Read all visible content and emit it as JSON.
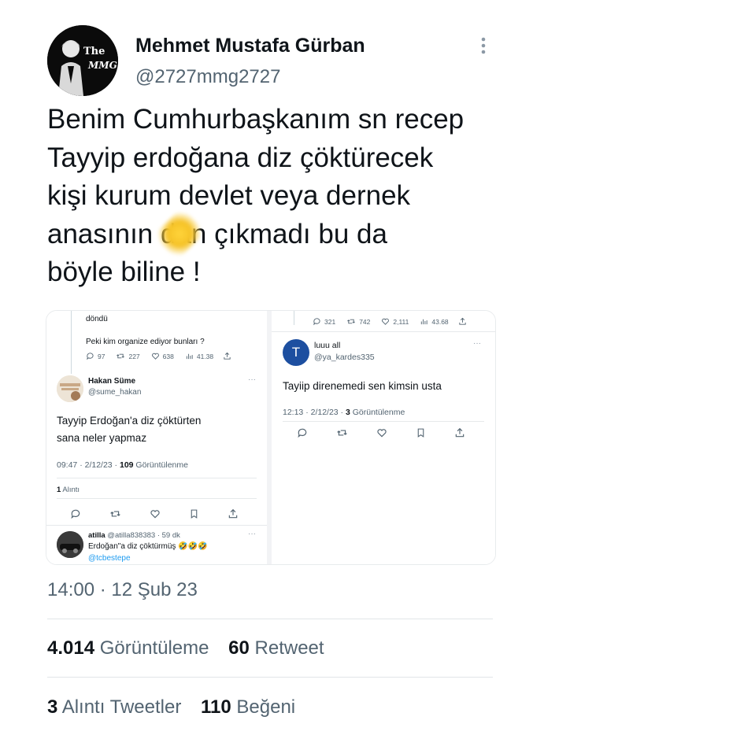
{
  "author": {
    "name": "Mehmet Mustafa Gürban",
    "handle": "@2727mmg2727",
    "avatar_text_top": "The",
    "avatar_text_bottom": "MMG"
  },
  "tweet": {
    "text_lines": [
      "Benim Cumhurbaşkanım sn recep",
      "Tayyip erdoğana diz çöktürecek",
      "kişi kurum devlet veya dernek",
      "anasının  dan  çıkmadı bu da",
      "böyle biline !"
    ],
    "timestamp": "14:00 · 12 Şub 23"
  },
  "stats": {
    "views_count": "4.014",
    "views_label": "Görüntüleme",
    "retweets_count": "60",
    "retweets_label": "Retweet",
    "quotes_count": "3",
    "quotes_label": "Alıntı Tweetler",
    "likes_count": "110",
    "likes_label": "Beğeni"
  },
  "media_left": {
    "top_fragment": "döndü",
    "question": "Peki kim organize ediyor bunları ?",
    "metrics_top": {
      "replies": "97",
      "retweets": "227",
      "likes": "638",
      "views": "41.38"
    },
    "user_name": "Hakan Süme",
    "user_handle": "@sume_hakan",
    "text_line1": "Tayyip Erdoğan'a diz çöktürten",
    "text_line2": "sana neler yapmaz",
    "meta_time": "09:47 · 2/12/23 · ",
    "meta_views_count": "109",
    "meta_views_label": " Görüntülenme",
    "quote_count": "1",
    "quote_label": " Alıntı",
    "reply_name": "atilla",
    "reply_handle_time": "@atilla838383 · 59 dk",
    "reply_text": "Erdoğan\"a diz çöktürmüş 🤣🤣🤣",
    "reply_mention": "@tcbestepe"
  },
  "media_right": {
    "metrics_top": {
      "replies": "321",
      "retweets": "742",
      "likes": "2,111",
      "views": "43.68"
    },
    "avatar_letter": "T",
    "user_name": "luuu all",
    "user_handle": "@ya_kardes335",
    "text": "Tayiip direnemedi sen kimsin usta",
    "meta_time": "12:13 · 2/12/23 · ",
    "meta_views_count": "3",
    "meta_views_label": " Görüntülenme"
  },
  "colors": {
    "text": "#0f1419",
    "secondary": "#536471",
    "link": "#1d9bf0",
    "avatar_blue": "#1d4fa0"
  },
  "icons": [
    "more-icon",
    "reply-icon",
    "retweet-icon",
    "like-icon",
    "bookmark-icon",
    "share-icon",
    "views-icon"
  ]
}
